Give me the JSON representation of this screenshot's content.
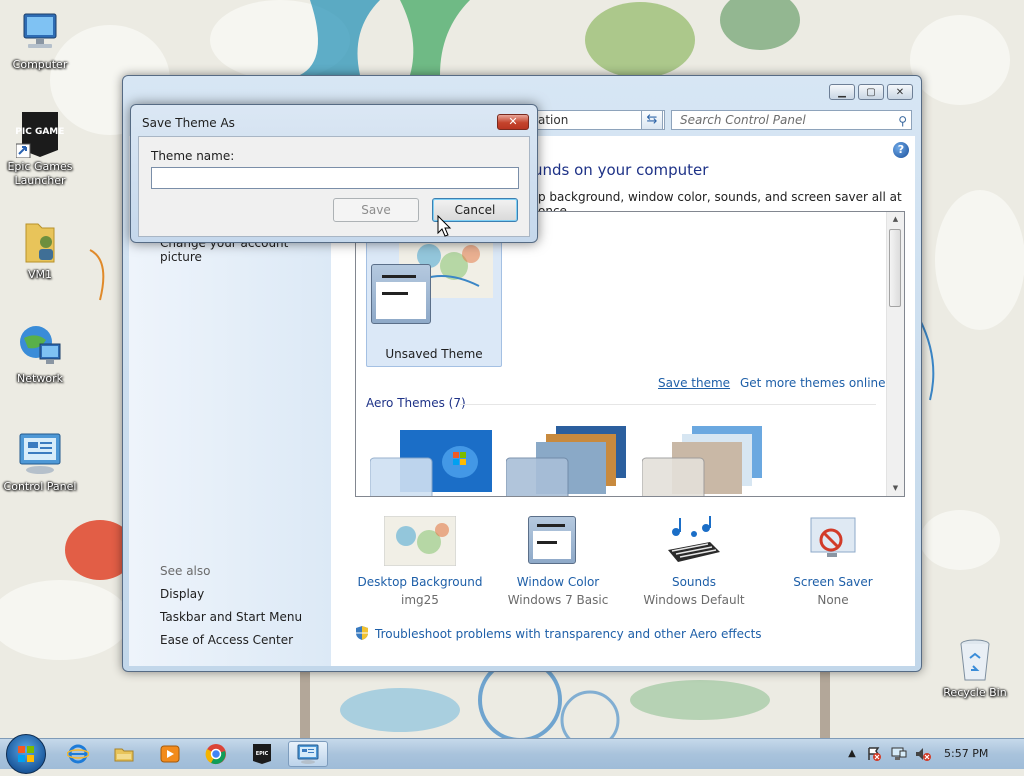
{
  "desktop": {
    "icons": [
      {
        "label": "Computer"
      },
      {
        "label": "Epic Games Launcher"
      },
      {
        "label": "VM1"
      },
      {
        "label": "Network"
      },
      {
        "label": "Control Panel"
      },
      {
        "label": "Recycle Bin"
      }
    ],
    "epic_logo_text": "EPIC GAMES"
  },
  "window": {
    "caption_buttons": [
      "minimize",
      "maximize",
      "close"
    ],
    "address_text": "ation",
    "search_placeholder": "Search Control Panel",
    "heading": "unds on your computer",
    "description": "p background, window color, sounds, and screen saver all at once.",
    "left_pane": {
      "account_link": "Change your account picture",
      "see_also_heading": "See also",
      "see_also_links": [
        "Display",
        "Taskbar and Start Menu",
        "Ease of Access Center"
      ]
    },
    "themes": {
      "unsaved_label": "Unsaved Theme",
      "save_theme_link": "Save theme",
      "get_more_link": "Get more themes online",
      "aero_heading": "Aero Themes (7)"
    },
    "settings": [
      {
        "name": "Desktop Background",
        "value": "img25",
        "icon": "wallpaper-icon"
      },
      {
        "name": "Window Color",
        "value": "Windows 7 Basic",
        "icon": "window-color-icon"
      },
      {
        "name": "Sounds",
        "value": "Windows Default",
        "icon": "sounds-icon"
      },
      {
        "name": "Screen Saver",
        "value": "None",
        "icon": "screen-saver-icon"
      }
    ],
    "troubleshoot_link": "Troubleshoot problems with transparency and other Aero effects"
  },
  "dialog": {
    "title": "Save Theme As",
    "field_label": "Theme name:",
    "field_value": "",
    "save_label": "Save",
    "cancel_label": "Cancel"
  },
  "taskbar": {
    "pinned": [
      "internet-explorer-icon",
      "windows-explorer-icon",
      "media-player-icon",
      "chrome-icon",
      "epic-games-icon",
      "control-panel-icon"
    ],
    "epic_label": "EPIC",
    "clock": "5:57 PM",
    "tray_arrow": "▲"
  }
}
